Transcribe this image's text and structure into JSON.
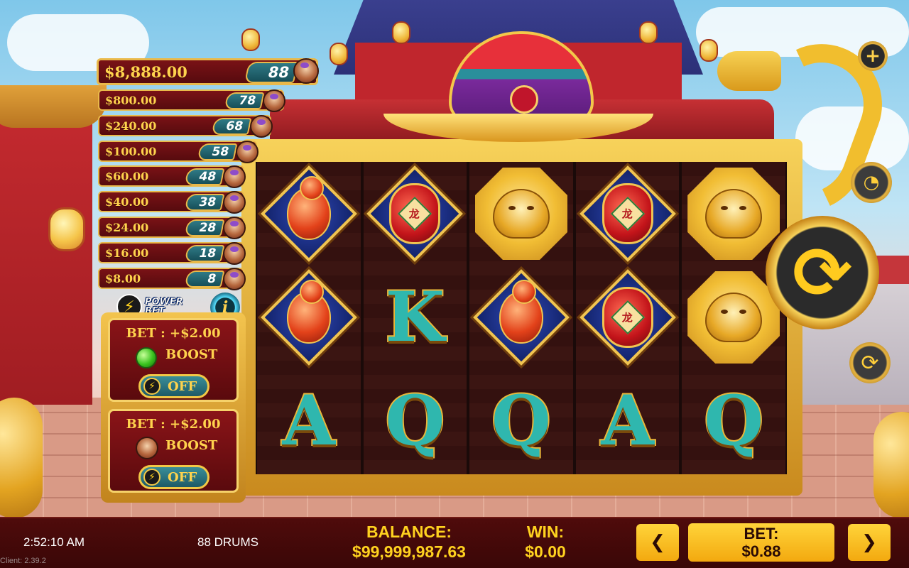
{
  "jackpots": [
    {
      "value": "$8,888.00",
      "count": "88"
    },
    {
      "value": "$800.00",
      "count": "78"
    },
    {
      "value": "$240.00",
      "count": "68"
    },
    {
      "value": "$100.00",
      "count": "58"
    },
    {
      "value": "$60.00",
      "count": "48"
    },
    {
      "value": "$40.00",
      "count": "38"
    },
    {
      "value": "$24.00",
      "count": "28"
    },
    {
      "value": "$16.00",
      "count": "18"
    },
    {
      "value": "$8.00",
      "count": "8"
    }
  ],
  "power_bet": {
    "label_line1": "POWER",
    "label_line2": "BET",
    "info_icon": "info-icon"
  },
  "boosts": [
    {
      "bet": "BET : +$2.00",
      "label": "BOOST",
      "toggle": "OFF",
      "icon": "green-gem-icon"
    },
    {
      "bet": "BET : +$2.00",
      "label": "BOOST",
      "toggle": "OFF",
      "icon": "drum-icon"
    }
  ],
  "reels": [
    [
      "gourd",
      "gourd",
      "A"
    ],
    [
      "lantern",
      "K",
      "Q"
    ],
    [
      "tiger",
      "gourd",
      "Q"
    ],
    [
      "lantern",
      "lantern",
      "A"
    ],
    [
      "tiger",
      "tiger",
      "Q"
    ]
  ],
  "lantern_glyph": "龙",
  "controls": {
    "plus": "+",
    "spin": "⟳",
    "auto": "⟳",
    "speed": "◔"
  },
  "bottom": {
    "clock": "2:52:10 AM",
    "game_name": "88 DRUMS",
    "balance_label": "BALANCE:",
    "balance_value": "$99,999,987.63",
    "win_label": "WIN:",
    "win_value": "$0.00",
    "bet_label": "BET:",
    "bet_value": "$0.88",
    "prev": "❮",
    "next": "❯",
    "client": "Client: 2.39.2"
  },
  "colors": {
    "gold": "#ffd21f",
    "bar": "#4f0b0b",
    "reel_bg": "#3b1512"
  }
}
